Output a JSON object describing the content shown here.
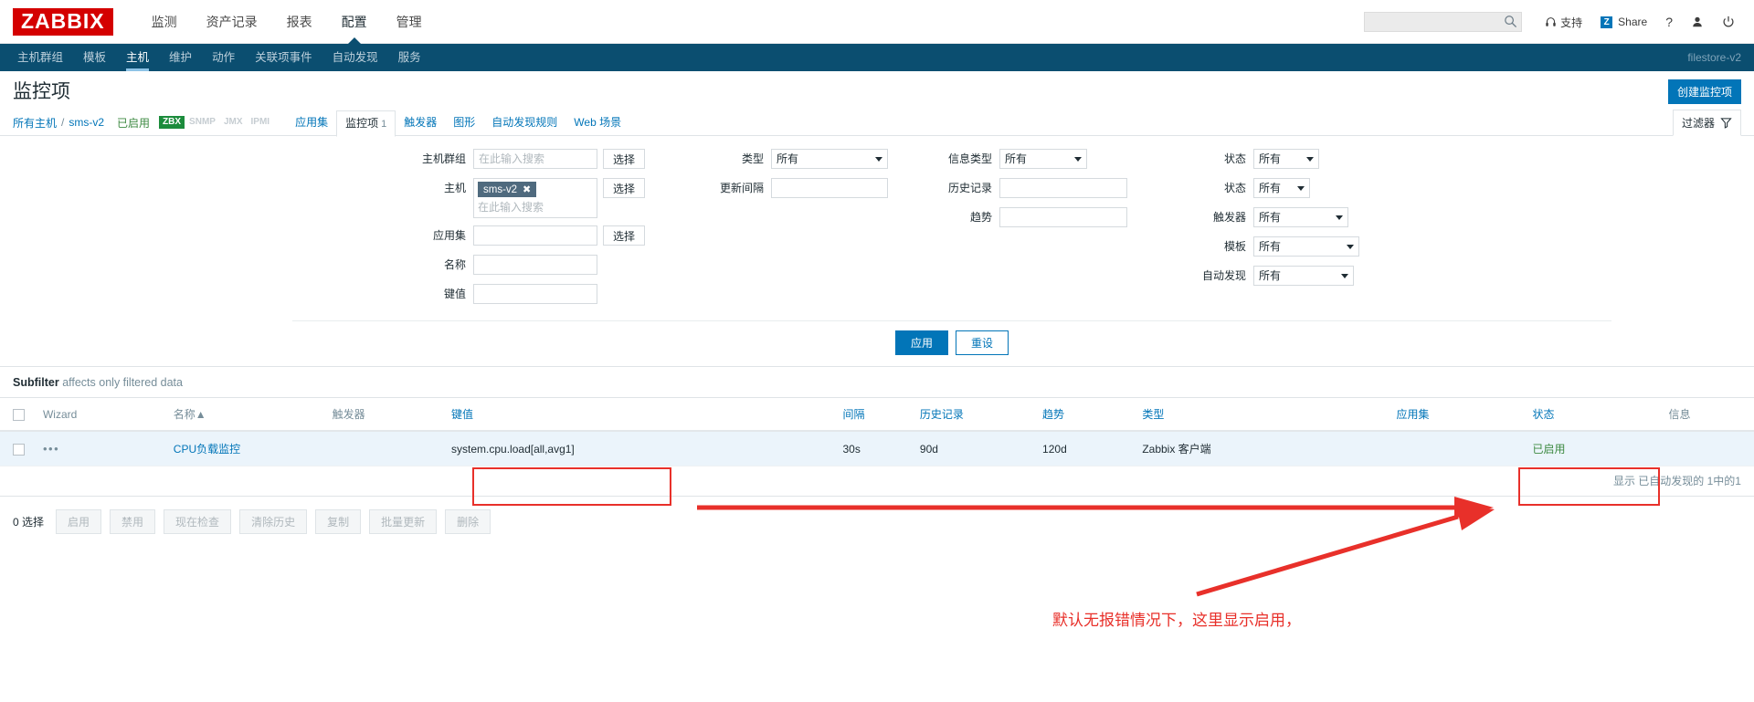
{
  "brand": {
    "logo": "ZABBIX",
    "logo_bg": "#d40000"
  },
  "mainnav": {
    "items": [
      {
        "label": "监测",
        "name": "monitoring",
        "selected": false
      },
      {
        "label": "资产记录",
        "name": "inventory",
        "selected": false
      },
      {
        "label": "报表",
        "name": "reports",
        "selected": false
      },
      {
        "label": "配置",
        "name": "configuration",
        "selected": true
      },
      {
        "label": "管理",
        "name": "administration",
        "selected": false
      }
    ]
  },
  "topright": {
    "search_placeholder": "",
    "search_value": "",
    "support_label": "支持",
    "share_label": "Share",
    "share_badge": "Z",
    "help_label": "?",
    "user_label": "",
    "signout_label": ""
  },
  "subnav": {
    "items": [
      {
        "label": "主机群组",
        "name": "host-groups",
        "selected": false
      },
      {
        "label": "模板",
        "name": "templates",
        "selected": false
      },
      {
        "label": "主机",
        "name": "hosts",
        "selected": true
      },
      {
        "label": "维护",
        "name": "maintenance",
        "selected": false
      },
      {
        "label": "动作",
        "name": "actions",
        "selected": false
      },
      {
        "label": "关联项事件",
        "name": "event-correlation",
        "selected": false
      },
      {
        "label": "自动发现",
        "name": "discovery",
        "selected": false
      },
      {
        "label": "服务",
        "name": "services",
        "selected": false
      }
    ],
    "right_label": "filestore-v2"
  },
  "page": {
    "title": "监控项",
    "create_button": "创建监控项"
  },
  "breadcrumb": {
    "all_hosts": "所有主机",
    "separator": "/",
    "host": "sms-v2",
    "status": "已启用",
    "interfaces": [
      {
        "label": "ZBX",
        "active": true
      },
      {
        "label": "SNMP",
        "active": false
      },
      {
        "label": "JMX",
        "active": false
      },
      {
        "label": "IPMI",
        "active": false
      }
    ],
    "tabs": [
      {
        "label": "应用集",
        "count": "",
        "selected": false
      },
      {
        "label": "监控项",
        "count": "1",
        "selected": true
      },
      {
        "label": "触发器",
        "count": "",
        "selected": false
      },
      {
        "label": "图形",
        "count": "",
        "selected": false
      },
      {
        "label": "自动发现规则",
        "count": "",
        "selected": false
      },
      {
        "label": "Web 场景",
        "count": "",
        "selected": false
      }
    ],
    "filter_toggle": "过滤器"
  },
  "filter": {
    "col1": {
      "host_group_label": "主机群组",
      "host_group_placeholder": "在此输入搜索",
      "host_group_value": "",
      "host_group_select": "选择",
      "host_label": "主机",
      "host_chip": "sms-v2",
      "host_placeholder": "在此输入搜索",
      "host_select": "选择",
      "appset_label": "应用集",
      "appset_value": "",
      "appset_select": "选择",
      "name_label": "名称",
      "name_value": "",
      "key_label": "键值",
      "key_value": ""
    },
    "col2": {
      "type_label": "类型",
      "type_value": "所有",
      "interval_label": "更新间隔",
      "interval_value": ""
    },
    "col3": {
      "info_type_label": "信息类型",
      "info_type_value": "所有",
      "history_label": "历史记录",
      "history_value": "",
      "trend_label": "趋势",
      "trend_value": ""
    },
    "col4": {
      "state_label": "状态",
      "state_value": "所有",
      "status_label": "状态",
      "status_value": "所有",
      "trigger_label": "触发器",
      "trigger_value": "所有",
      "template_label": "模板",
      "template_value": "所有",
      "discovery_label": "自动发现",
      "discovery_value": "所有"
    },
    "apply_label": "应用",
    "reset_label": "重设"
  },
  "subfilter": {
    "title": "Subfilter",
    "hint": "affects only filtered data"
  },
  "table": {
    "columns": [
      {
        "label": "",
        "name": "checkbox"
      },
      {
        "label": "Wizard",
        "name": "wizard"
      },
      {
        "label": "名称",
        "name": "name",
        "sorted": true,
        "sort_arrow": "▲"
      },
      {
        "label": "触发器",
        "name": "triggers"
      },
      {
        "label": "键值",
        "name": "key",
        "link": true
      },
      {
        "label": "间隔",
        "name": "interval",
        "link": true
      },
      {
        "label": "历史记录",
        "name": "history",
        "link": true
      },
      {
        "label": "趋势",
        "name": "trends",
        "link": true
      },
      {
        "label": "类型",
        "name": "type",
        "link": true
      },
      {
        "label": "应用集",
        "name": "applications",
        "link": true
      },
      {
        "label": "状态",
        "name": "status",
        "link": true
      },
      {
        "label": "信息",
        "name": "info"
      }
    ],
    "rows": [
      {
        "wizard": "•••",
        "name": "CPU负载监控",
        "triggers": "",
        "key": "system.cpu.load[all,avg1]",
        "interval": "30s",
        "history": "90d",
        "trends": "120d",
        "type": "Zabbix 客户端",
        "applications": "",
        "status": "已启用",
        "info": ""
      }
    ],
    "footer": "显示 已自动发现的 1中的1"
  },
  "bottom_actions": {
    "selected_count": "0 选择",
    "buttons": [
      {
        "label": "启用",
        "name": "enable"
      },
      {
        "label": "禁用",
        "name": "disable"
      },
      {
        "label": "现在检查",
        "name": "check-now"
      },
      {
        "label": "清除历史",
        "name": "clear-history"
      },
      {
        "label": "复制",
        "name": "copy"
      },
      {
        "label": "批量更新",
        "name": "mass-update"
      },
      {
        "label": "删除",
        "name": "delete"
      }
    ]
  },
  "annotation": {
    "text": "默认无报错情况下，这里显示启用，",
    "color": "#e8302a"
  }
}
